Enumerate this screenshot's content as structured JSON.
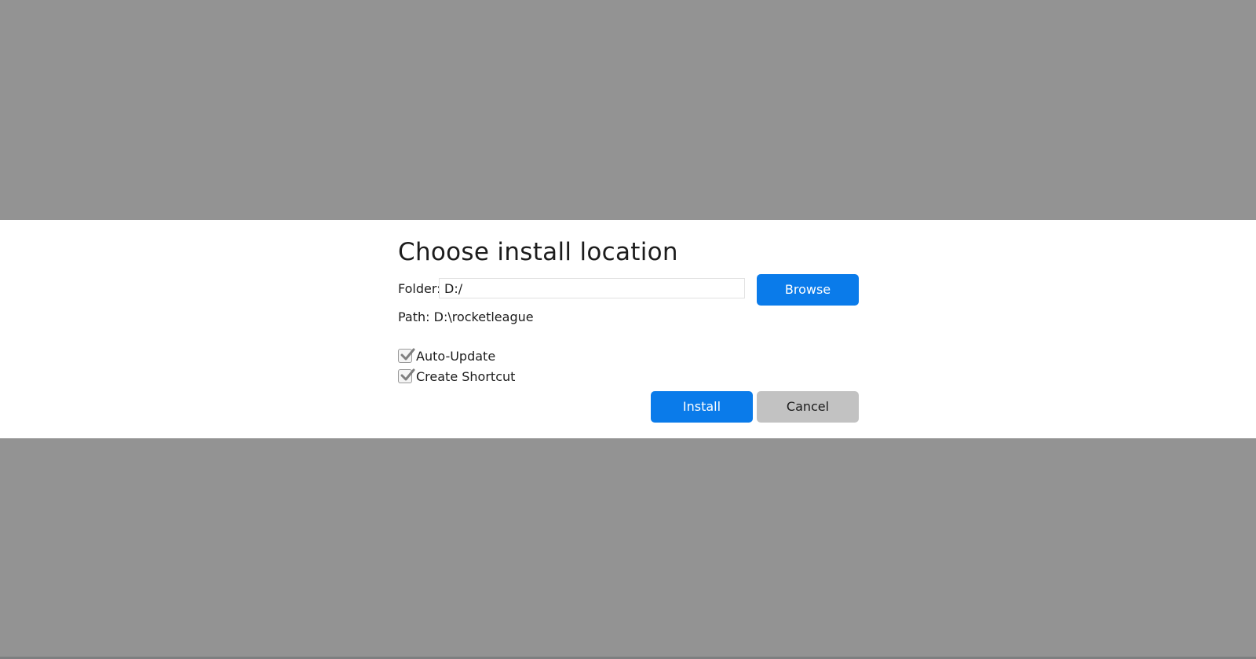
{
  "dialog": {
    "title": "Choose install location",
    "folder_label": "Folder:",
    "folder_value": "D:/",
    "browse_label": "Browse",
    "path_label": "Path:",
    "path_value": "D:\\rocketleague",
    "options": [
      {
        "label": "Auto-Update",
        "checked": true
      },
      {
        "label": "Create Shortcut",
        "checked": true
      }
    ],
    "install_label": "Install",
    "cancel_label": "Cancel"
  },
  "colors": {
    "backdrop": "#939393",
    "dialog_bg": "#ffffff",
    "primary_button": "#0a7bea",
    "secondary_button": "#c2c2c2",
    "checkmark": "#7f7f7f"
  },
  "icons": {
    "checkbox": "checkmark-icon"
  }
}
